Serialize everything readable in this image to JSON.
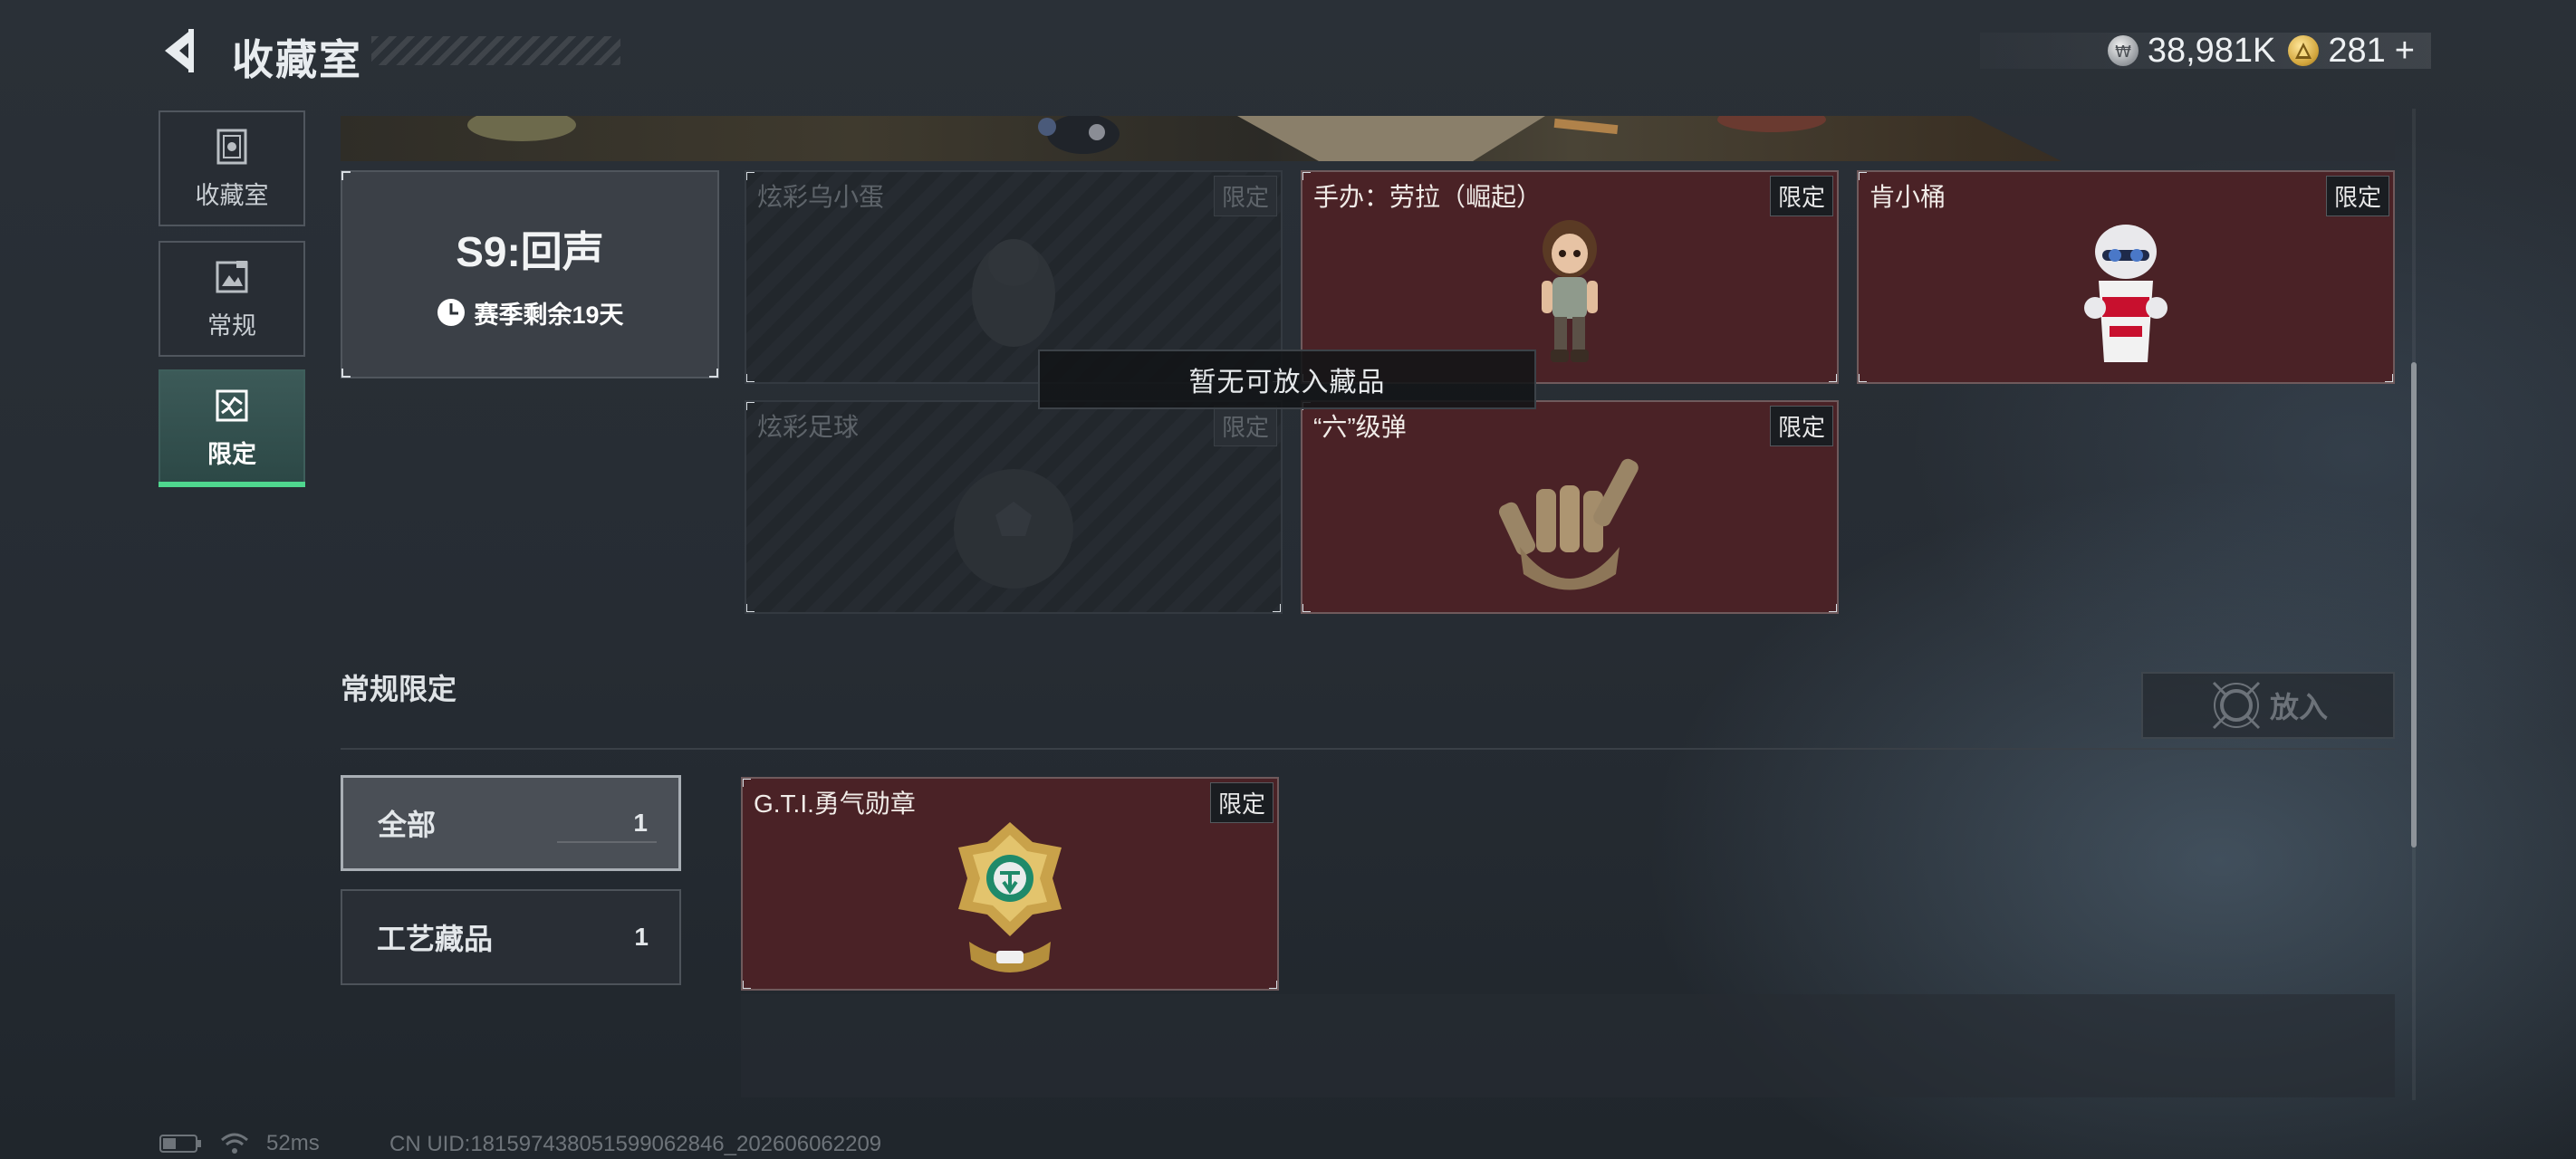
{
  "header": {
    "title": "收藏室",
    "currency": [
      {
        "icon": "silver-coin-icon",
        "value": "38,981K"
      },
      {
        "icon": "gold-coin-icon",
        "value": "281"
      }
    ],
    "add_symbol": "+"
  },
  "sidenav": {
    "items": [
      {
        "label": "收藏室",
        "icon": "collection-room-icon"
      },
      {
        "label": "常规",
        "icon": "regular-icon"
      },
      {
        "label": "限定",
        "icon": "limited-icon",
        "active": true
      }
    ]
  },
  "season": {
    "title": "S9:回声",
    "remaining": "赛季剩余19天"
  },
  "items": [
    {
      "name": "炫彩乌小蛋",
      "tag": "限定",
      "owned": false
    },
    {
      "name": "手办：劳拉（崛起）",
      "tag": "限定",
      "owned": true
    },
    {
      "name": "肯小桶",
      "tag": "限定",
      "owned": true
    },
    {
      "name": "炫彩足球",
      "tag": "限定",
      "owned": false
    },
    {
      "name": "“六”级弹",
      "tag": "限定",
      "owned": true
    }
  ],
  "toast": "暂无可放入藏品",
  "section": {
    "title": "常规限定",
    "put_in_label": "放入",
    "filters": [
      {
        "label": "全部",
        "count": "1",
        "active": true
      },
      {
        "label": "工艺藏品",
        "count": "1",
        "active": false
      }
    ],
    "items": [
      {
        "name": "G.T.I.勇气勋章",
        "tag": "限定",
        "owned": true
      }
    ]
  },
  "status": {
    "ping": "52ms",
    "uid": "CN UID:1815974380515990628​46_202606062209"
  },
  "colors": {
    "accent_green": "#4fd68e",
    "owned_card_bg": "#4a2226",
    "page_bg": "#2a3037"
  }
}
